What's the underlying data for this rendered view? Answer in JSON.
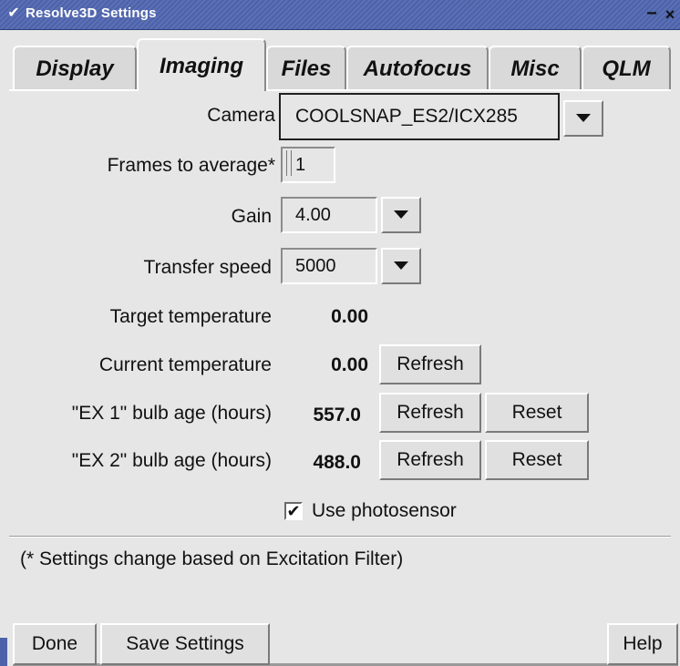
{
  "window": {
    "title": "Resolve3D Settings",
    "minimize_glyph": "−",
    "close_glyph": "×"
  },
  "tabs": [
    {
      "label": "Display",
      "active": false
    },
    {
      "label": "Imaging",
      "active": true
    },
    {
      "label": "Files",
      "active": false
    },
    {
      "label": "Autofocus",
      "active": false
    },
    {
      "label": "Misc",
      "active": false
    },
    {
      "label": "QLM",
      "active": false
    }
  ],
  "imaging": {
    "camera": {
      "label": "Camera",
      "value": "COOLSNAP_ES2/ICX285"
    },
    "frames": {
      "label": "Frames to average*",
      "value": "1"
    },
    "gain": {
      "label": "Gain",
      "value": "4.00"
    },
    "transfer_speed": {
      "label": "Transfer speed",
      "value": "5000"
    },
    "target_temperature": {
      "label": "Target temperature",
      "value": "0.00"
    },
    "current_temperature": {
      "label": "Current temperature",
      "value": "0.00",
      "refresh_label": "Refresh"
    },
    "bulb1": {
      "label": "\"EX 1\" bulb age (hours)",
      "value": "557.0",
      "refresh_label": "Refresh",
      "reset_label": "Reset"
    },
    "bulb2": {
      "label": "\"EX 2\" bulb age (hours)",
      "value": "488.0",
      "refresh_label": "Refresh",
      "reset_label": "Reset"
    },
    "photosensor": {
      "label": "Use photosensor",
      "checked": true,
      "check_glyph": "✔"
    }
  },
  "note": "(* Settings change based on Excitation Filter)",
  "footer": {
    "done_label": "Done",
    "save_label": "Save Settings",
    "help_label": "Help"
  },
  "colors": {
    "titlebar": "#4d62a8",
    "background": "#e6e6e6"
  }
}
